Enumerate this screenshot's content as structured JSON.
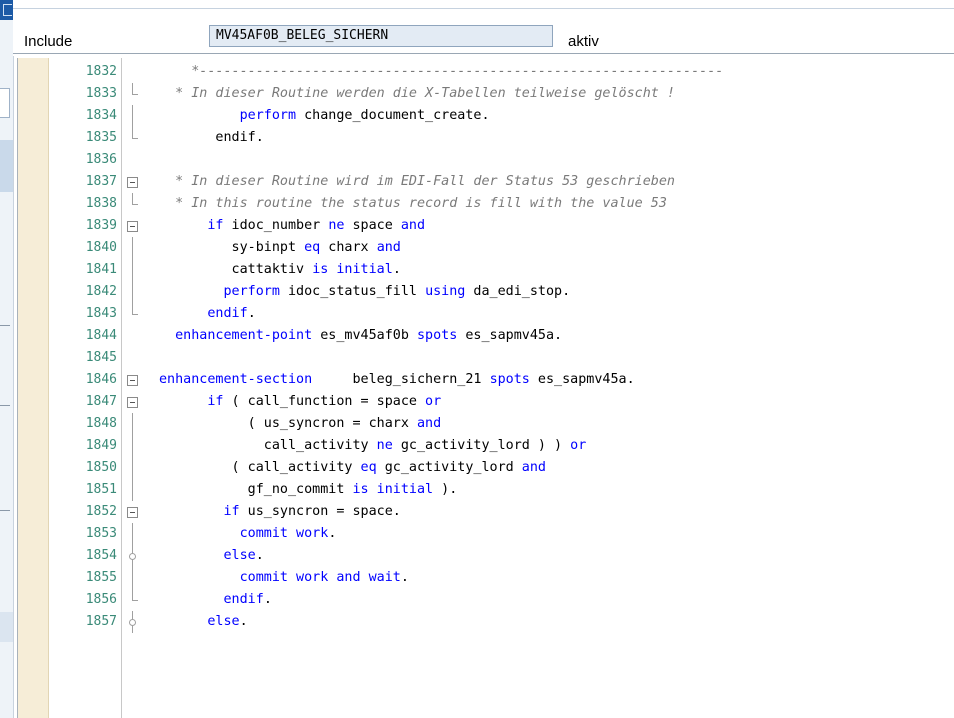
{
  "header": {
    "include_label": "Include",
    "program_name": "MV45AF0B_BELEG_SICHERN",
    "status": "aktiv"
  },
  "code_lines": [
    {
      "num": "1832",
      "fold": "none",
      "tokens": [
        [
          "c",
          "    *-----------------------------------------------------------------"
        ]
      ]
    },
    {
      "num": "1833",
      "fold": "tick",
      "tokens": [
        [
          "c",
          "  * In dieser Routine werden die X-Tabellen teilweise gelöscht !"
        ]
      ]
    },
    {
      "num": "1834",
      "fold": "line",
      "tokens": [
        [
          "t",
          "          "
        ],
        [
          "k",
          "perform"
        ],
        [
          "t",
          " change_document_create."
        ]
      ]
    },
    {
      "num": "1835",
      "fold": "tick",
      "tokens": [
        [
          "t",
          "       endif."
        ]
      ]
    },
    {
      "num": "1836",
      "fold": "none",
      "tokens": []
    },
    {
      "num": "1837",
      "fold": "box",
      "tokens": [
        [
          "c",
          "  * In dieser Routine wird im EDI-Fall der Status 53 geschrieben"
        ]
      ]
    },
    {
      "num": "1838",
      "fold": "tick",
      "tokens": [
        [
          "c",
          "  * In this routine the status record is fill with the value 53"
        ]
      ]
    },
    {
      "num": "1839",
      "fold": "box",
      "tokens": [
        [
          "t",
          "      "
        ],
        [
          "k",
          "if"
        ],
        [
          "t",
          " idoc_number "
        ],
        [
          "k",
          "ne"
        ],
        [
          "t",
          " space "
        ],
        [
          "k",
          "and"
        ]
      ]
    },
    {
      "num": "1840",
      "fold": "line",
      "tokens": [
        [
          "t",
          "         sy-binpt "
        ],
        [
          "k",
          "eq"
        ],
        [
          "t",
          " charx "
        ],
        [
          "k",
          "and"
        ]
      ]
    },
    {
      "num": "1841",
      "fold": "line",
      "tokens": [
        [
          "t",
          "         cattaktiv "
        ],
        [
          "k",
          "is initial"
        ],
        [
          "t",
          "."
        ]
      ]
    },
    {
      "num": "1842",
      "fold": "line",
      "tokens": [
        [
          "t",
          "        "
        ],
        [
          "k",
          "perform"
        ],
        [
          "t",
          " idoc_status_fill "
        ],
        [
          "k",
          "using"
        ],
        [
          "t",
          " da_edi_stop."
        ]
      ]
    },
    {
      "num": "1843",
      "fold": "tick",
      "tokens": [
        [
          "t",
          "      "
        ],
        [
          "k",
          "endif"
        ],
        [
          "t",
          "."
        ]
      ]
    },
    {
      "num": "1844",
      "fold": "none",
      "tokens": [
        [
          "t",
          "  "
        ],
        [
          "k",
          "enhancement-point"
        ],
        [
          "t",
          " es_mv45af0b "
        ],
        [
          "k",
          "spots"
        ],
        [
          "t",
          " es_sapmv45a."
        ]
      ]
    },
    {
      "num": "1845",
      "fold": "none",
      "tokens": []
    },
    {
      "num": "1846",
      "fold": "box",
      "tokens": [
        [
          "k",
          "enhancement-section"
        ],
        [
          "t",
          "     beleg_sichern_21 "
        ],
        [
          "k",
          "spots"
        ],
        [
          "t",
          " es_sapmv45a."
        ]
      ]
    },
    {
      "num": "1847",
      "fold": "box",
      "tokens": [
        [
          "t",
          "      "
        ],
        [
          "k",
          "if"
        ],
        [
          "t",
          " ( call_function = space "
        ],
        [
          "k",
          "or"
        ]
      ]
    },
    {
      "num": "1848",
      "fold": "line",
      "tokens": [
        [
          "t",
          "           ( us_syncron = charx "
        ],
        [
          "k",
          "and"
        ]
      ]
    },
    {
      "num": "1849",
      "fold": "line",
      "tokens": [
        [
          "t",
          "             call_activity "
        ],
        [
          "k",
          "ne"
        ],
        [
          "t",
          " gc_activity_lord ) ) "
        ],
        [
          "k",
          "or"
        ]
      ]
    },
    {
      "num": "1850",
      "fold": "line",
      "tokens": [
        [
          "t",
          "         ( call_activity "
        ],
        [
          "k",
          "eq"
        ],
        [
          "t",
          " gc_activity_lord "
        ],
        [
          "k",
          "and"
        ]
      ]
    },
    {
      "num": "1851",
      "fold": "line",
      "tokens": [
        [
          "t",
          "           gf_no_commit "
        ],
        [
          "k",
          "is initial"
        ],
        [
          "t",
          " )."
        ]
      ]
    },
    {
      "num": "1852",
      "fold": "box",
      "tokens": [
        [
          "t",
          "        "
        ],
        [
          "k",
          "if"
        ],
        [
          "t",
          " us_syncron = space."
        ]
      ]
    },
    {
      "num": "1853",
      "fold": "line",
      "tokens": [
        [
          "t",
          "          "
        ],
        [
          "k",
          "commit work"
        ],
        [
          "t",
          "."
        ]
      ]
    },
    {
      "num": "1854",
      "fold": "dot",
      "tokens": [
        [
          "t",
          "        "
        ],
        [
          "k",
          "else"
        ],
        [
          "t",
          "."
        ]
      ]
    },
    {
      "num": "1855",
      "fold": "line",
      "tokens": [
        [
          "t",
          "          "
        ],
        [
          "k",
          "commit work and wait"
        ],
        [
          "t",
          "."
        ]
      ]
    },
    {
      "num": "1856",
      "fold": "tick",
      "tokens": [
        [
          "t",
          "        "
        ],
        [
          "k",
          "endif"
        ],
        [
          "t",
          "."
        ]
      ]
    },
    {
      "num": "1857",
      "fold": "dot",
      "tokens": [
        [
          "t",
          "      "
        ],
        [
          "k",
          "else"
        ],
        [
          "t",
          "."
        ]
      ]
    }
  ]
}
